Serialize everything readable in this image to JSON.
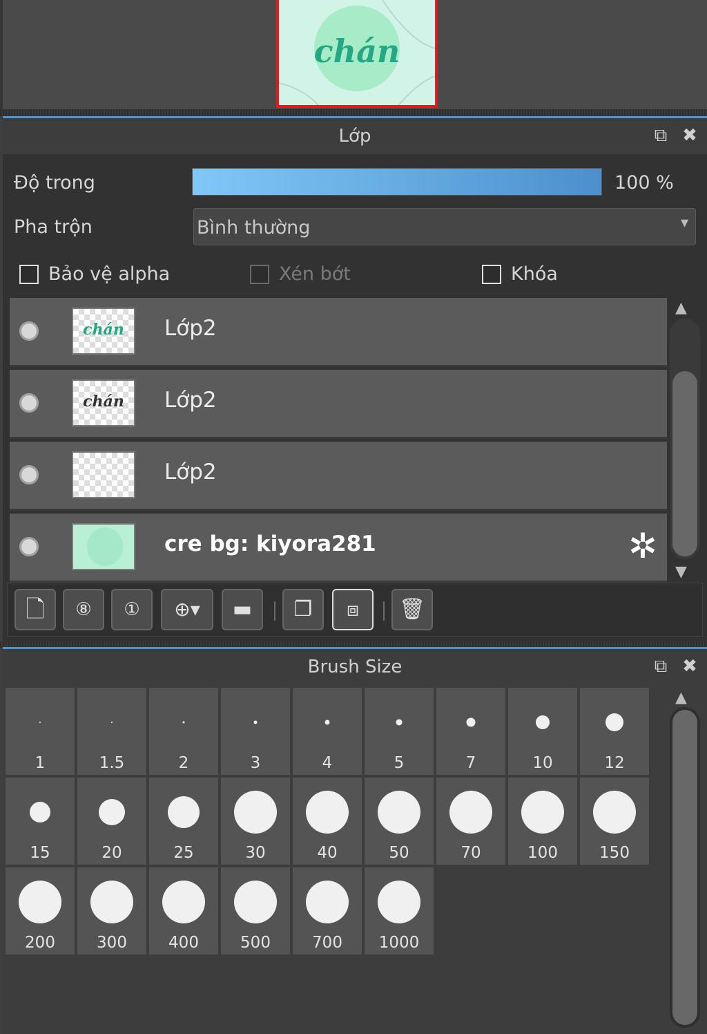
{
  "navigator": {
    "thumb_text": "chán"
  },
  "layers_panel": {
    "title": "Lớp",
    "opacity_label": "Độ trong",
    "opacity_value": "100 %",
    "opacity_fraction": 1.0,
    "blend_label": "Pha trộn",
    "blend_value": "Bình thường",
    "check_alpha": "Bảo vệ alpha",
    "check_clip": "Xén bớt",
    "check_lock": "Khóa",
    "layers": [
      {
        "name": "Lớp2",
        "thumb": "chán"
      },
      {
        "name": "Lớp2",
        "thumb": "chán"
      },
      {
        "name": "Lớp2",
        "thumb": ""
      },
      {
        "name": "cre bg: kiyora281",
        "thumb": ""
      }
    ]
  },
  "brush_panel": {
    "title": "Brush Size",
    "sizes": [
      "1",
      "1.5",
      "2",
      "3",
      "4",
      "5",
      "7",
      "10",
      "12",
      "15",
      "20",
      "25",
      "30",
      "40",
      "50",
      "70",
      "100",
      "150",
      "200",
      "300",
      "400",
      "500",
      "700",
      "1000"
    ]
  },
  "colors": {
    "accent": "#4c96d0",
    "panel_bg": "#323232",
    "selection_border": "#e11b1b"
  }
}
